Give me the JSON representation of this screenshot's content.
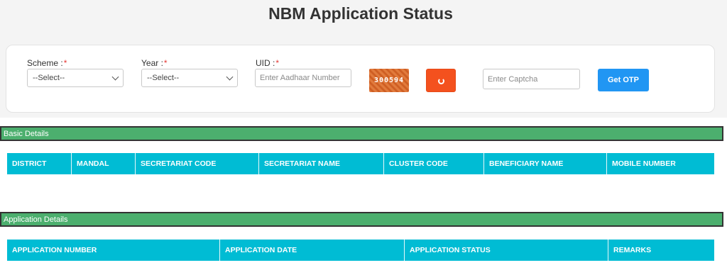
{
  "page": {
    "title": "NBM Application Status"
  },
  "form": {
    "scheme": {
      "label": "Scheme :",
      "required_mark": "*",
      "selected": "--Select--"
    },
    "year": {
      "label": "Year :",
      "required_mark": "*",
      "selected": "--Select--"
    },
    "uid": {
      "label": "UID :",
      "required_mark": "*",
      "placeholder": "Enter Aadhaar Number"
    },
    "captcha_code": "300594",
    "captcha_input": {
      "placeholder": "Enter Captcha"
    },
    "get_otp_label": "Get OTP"
  },
  "basic_details": {
    "title": "Basic Details",
    "columns": [
      "DISTRICT",
      "MANDAL",
      "SECRETARIAT CODE",
      "SECRETARIAT NAME",
      "CLUSTER CODE",
      "BENEFICIARY NAME",
      "MOBILE NUMBER"
    ]
  },
  "application_details": {
    "title": "Application Details",
    "columns": [
      "APPLICATION NUMBER",
      "APPLICATION DATE",
      "APPLICATION STATUS",
      "REMARKS"
    ]
  },
  "colors": {
    "section_bar": "#4caf6e",
    "table_header": "#00bcd4",
    "otp_button": "#2196f3",
    "refresh_button": "#f4511e",
    "required": "#e53935"
  },
  "icons": {
    "refresh": "refresh-icon",
    "dropdown": "chevron-down-icon"
  }
}
